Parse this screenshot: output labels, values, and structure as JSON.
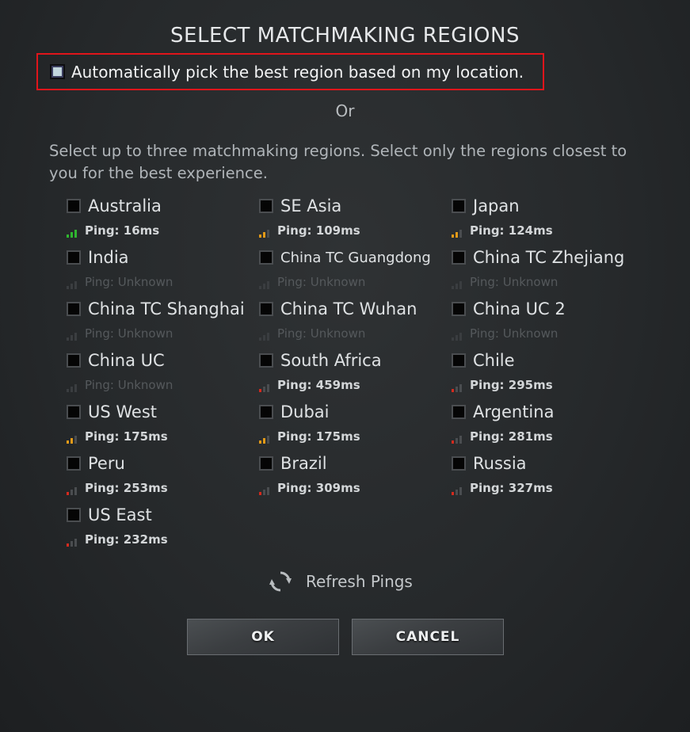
{
  "title": "SELECT MATCHMAKING REGIONS",
  "auto_pick": {
    "label": "Automatically pick the best region based on my location.",
    "checked": true
  },
  "or_text": "Or",
  "instructions": "Select up to three matchmaking regions. Select only the regions closest to you for the best experience.",
  "ping_colors": {
    "good": "#2fb52f",
    "medium": "#e39a18",
    "bad": "#d42a1e",
    "unknown": "#4a4d50"
  },
  "regions": [
    {
      "name": "Australia",
      "ping": "Ping: 16ms",
      "quality": "good",
      "bars": 3
    },
    {
      "name": "SE Asia",
      "ping": "Ping: 109ms",
      "quality": "medium",
      "bars": 2
    },
    {
      "name": "Japan",
      "ping": "Ping: 124ms",
      "quality": "medium",
      "bars": 2
    },
    {
      "name": "India",
      "ping": "Ping: Unknown",
      "quality": "unknown",
      "bars": 0
    },
    {
      "name": "China TC Guangdong",
      "ping": "Ping: Unknown",
      "quality": "unknown",
      "bars": 0
    },
    {
      "name": "China TC Zhejiang",
      "ping": "Ping: Unknown",
      "quality": "unknown",
      "bars": 0
    },
    {
      "name": "China TC Shanghai",
      "ping": "Ping: Unknown",
      "quality": "unknown",
      "bars": 0
    },
    {
      "name": "China TC Wuhan",
      "ping": "Ping: Unknown",
      "quality": "unknown",
      "bars": 0
    },
    {
      "name": "China UC 2",
      "ping": "Ping: Unknown",
      "quality": "unknown",
      "bars": 0
    },
    {
      "name": "China UC",
      "ping": "Ping: Unknown",
      "quality": "unknown",
      "bars": 0
    },
    {
      "name": "South Africa",
      "ping": "Ping: 459ms",
      "quality": "bad",
      "bars": 1
    },
    {
      "name": "Chile",
      "ping": "Ping: 295ms",
      "quality": "bad",
      "bars": 1
    },
    {
      "name": "US West",
      "ping": "Ping: 175ms",
      "quality": "medium",
      "bars": 2
    },
    {
      "name": "Dubai",
      "ping": "Ping: 175ms",
      "quality": "medium",
      "bars": 2
    },
    {
      "name": "Argentina",
      "ping": "Ping: 281ms",
      "quality": "bad",
      "bars": 1
    },
    {
      "name": "Peru",
      "ping": "Ping: 253ms",
      "quality": "bad",
      "bars": 1
    },
    {
      "name": "Brazil",
      "ping": "Ping: 309ms",
      "quality": "bad",
      "bars": 1
    },
    {
      "name": "Russia",
      "ping": "Ping: 327ms",
      "quality": "bad",
      "bars": 1
    },
    {
      "name": "US East",
      "ping": "Ping: 232ms",
      "quality": "bad",
      "bars": 1
    }
  ],
  "refresh": {
    "label": "Refresh Pings",
    "icon": "refresh-icon"
  },
  "buttons": {
    "ok": "OK",
    "cancel": "CANCEL"
  }
}
